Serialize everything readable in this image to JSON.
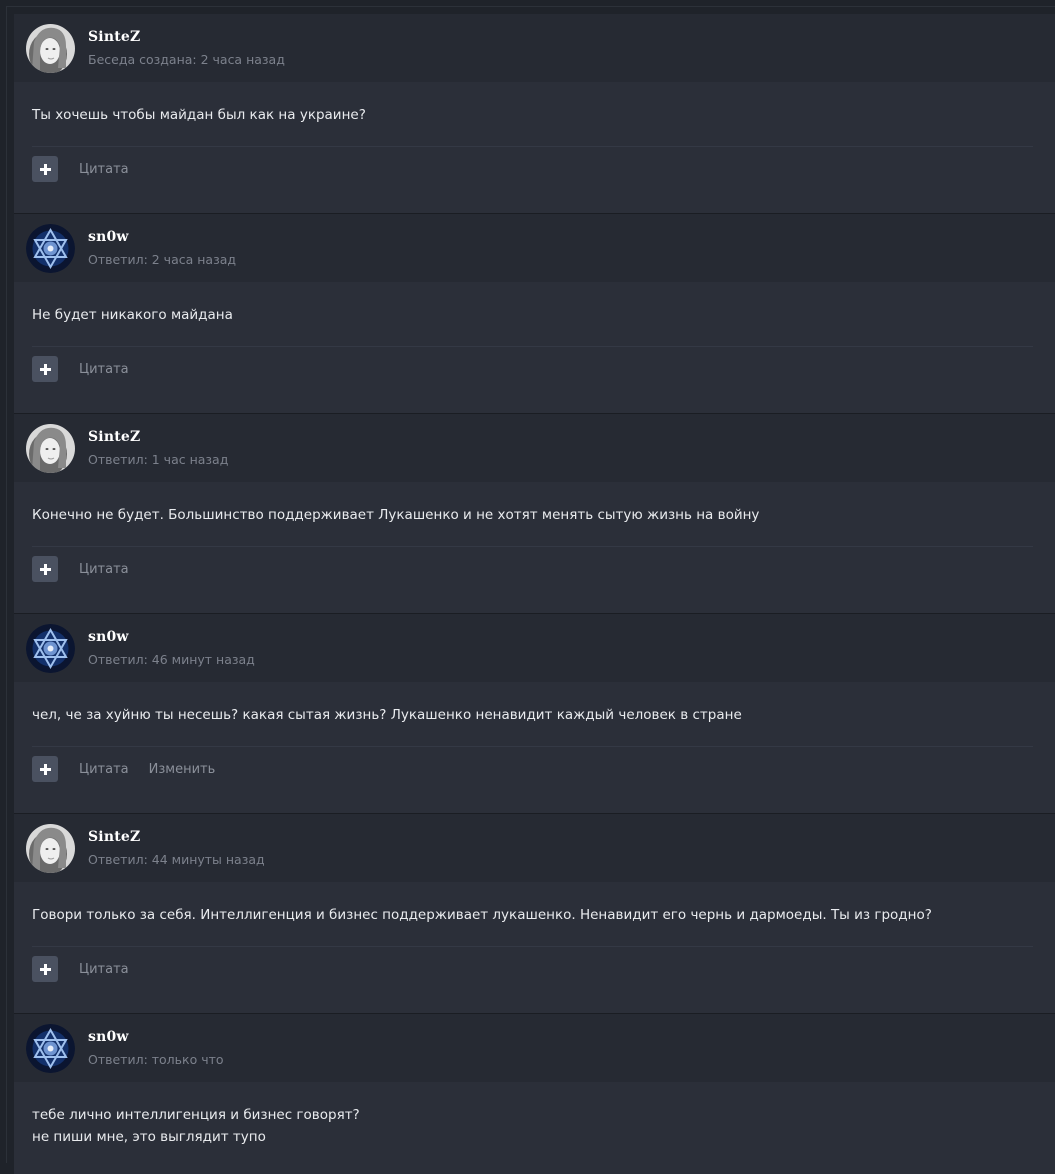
{
  "posts": [
    {
      "author": "SinteZ",
      "avatar_icon": "girl-portrait-avatar",
      "meta": "Беседа создана: 2 часа назад",
      "lines": [
        "Ты хочешь чтобы майдан был как на украине?"
      ],
      "actions": [
        "Цитата"
      ]
    },
    {
      "author": "sn0w",
      "avatar_icon": "star-emblem-avatar",
      "meta": "Ответил: 2 часа назад",
      "lines": [
        "Не будет никакого майдана"
      ],
      "actions": [
        "Цитата"
      ]
    },
    {
      "author": "SinteZ",
      "avatar_icon": "girl-portrait-avatar",
      "meta": "Ответил: 1 час назад",
      "lines": [
        "Конечно не будет. Большинство поддерживает Лукашенко и не хотят менять сытую жизнь на войну"
      ],
      "actions": [
        "Цитата"
      ]
    },
    {
      "author": "sn0w",
      "avatar_icon": "star-emblem-avatar",
      "meta": "Ответил: 46 минут назад",
      "lines": [
        "чел, че за хуйню ты несешь? какая сытая жизнь? Лукашенко ненавидит каждый человек в стране"
      ],
      "actions": [
        "Цитата",
        "Изменить"
      ]
    },
    {
      "author": "SinteZ",
      "avatar_icon": "girl-portrait-avatar",
      "meta": "Ответил: 44 минуты назад",
      "lines": [
        "Говори только за себя. Интеллигенция и бизнес поддерживает лукашенко. Ненавидит его чернь и дармоеды. Ты из гродно?"
      ],
      "actions": [
        "Цитата"
      ]
    },
    {
      "author": "sn0w",
      "avatar_icon": "star-emblem-avatar",
      "meta": "Ответил: только что",
      "lines": [
        "тебе лично интеллигенция и бизнес говорят?",
        "не пиши мне, это выглядит тупо"
      ],
      "actions": []
    }
  ],
  "colors": {
    "page_bg": "#1f232a",
    "post_bg": "#2b2f39",
    "header_bg": "#262a33",
    "text": "#e9ebee",
    "muted": "#7c818c",
    "button_bg": "#4a5160"
  }
}
